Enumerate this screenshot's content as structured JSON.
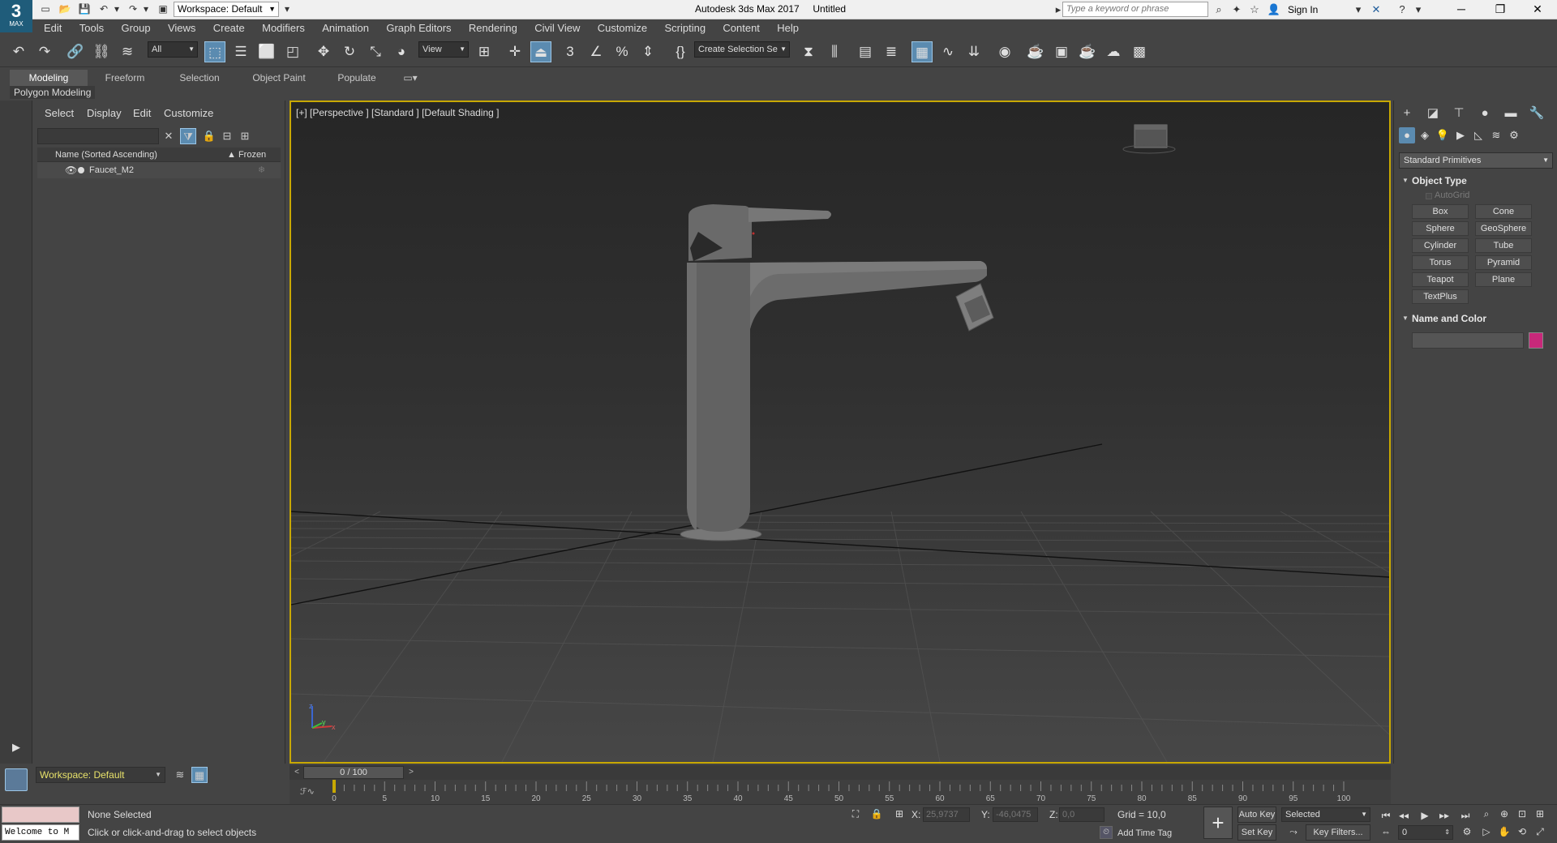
{
  "app": {
    "logo_big": "3",
    "logo_small": "MAX",
    "title": "Autodesk 3ds Max 2017",
    "document": "Untitled",
    "workspace": "Workspace: Default",
    "search_placeholder": "Type a keyword or phrase",
    "sign_in": "Sign In"
  },
  "menu": [
    "Edit",
    "Tools",
    "Group",
    "Views",
    "Create",
    "Modifiers",
    "Animation",
    "Graph Editors",
    "Rendering",
    "Civil View",
    "Customize",
    "Scripting",
    "Content",
    "Help"
  ],
  "toolbar": {
    "selection_filter": "All",
    "ref_coord": "View",
    "named_selection": "Create Selection Se"
  },
  "ribbon": {
    "tabs": [
      "Modeling",
      "Freeform",
      "Selection",
      "Object Paint",
      "Populate"
    ],
    "active_tab": "Modeling",
    "panel_label": "Polygon Modeling"
  },
  "scene_explorer": {
    "menu": [
      "Select",
      "Display",
      "Edit",
      "Customize"
    ],
    "columns": {
      "name": "Name (Sorted Ascending)",
      "frozen": "▲ Frozen"
    },
    "rows": [
      {
        "name": "Faucet_M2"
      }
    ],
    "workspace": "Workspace: Default"
  },
  "viewport": {
    "label": "[+] [Perspective ] [Standard ] [Default Shading ]",
    "axis_z": "z",
    "axis_x": "x",
    "axis_y": "y"
  },
  "command_panel": {
    "category": "Standard Primitives",
    "object_type_title": "Object Type",
    "autogrid": "AutoGrid",
    "buttons": [
      "Box",
      "Cone",
      "Sphere",
      "GeoSphere",
      "Cylinder",
      "Tube",
      "Torus",
      "Pyramid",
      "Teapot",
      "Plane",
      "TextPlus"
    ],
    "name_color_title": "Name and Color",
    "swatch_color": "#c8287a"
  },
  "time": {
    "position": "0 / 100",
    "ticks": [
      "0",
      "5",
      "10",
      "15",
      "20",
      "25",
      "30",
      "35",
      "40",
      "45",
      "50",
      "55",
      "60",
      "65",
      "70",
      "75",
      "80",
      "85",
      "90",
      "95",
      "100"
    ]
  },
  "status": {
    "maxscript_listener": "Welcome to M",
    "selection": "None Selected",
    "prompt": "Click or click-and-drag to select objects",
    "x_label": "X:",
    "x_value": "25,9737",
    "y_label": "Y:",
    "y_value": "-46,0475",
    "z_label": "Z:",
    "z_value": "0,0",
    "grid": "Grid = 10,0",
    "add_time_tag": "Add Time Tag",
    "auto_key": "Auto Key",
    "set_key": "Set Key",
    "key_mode": "Selected",
    "key_filters": "Key Filters...",
    "frame": "0"
  },
  "colors": {
    "viewport_border": "#c8a800",
    "active_button": "#5b8bb0",
    "faucet": "#6a6a6a"
  }
}
